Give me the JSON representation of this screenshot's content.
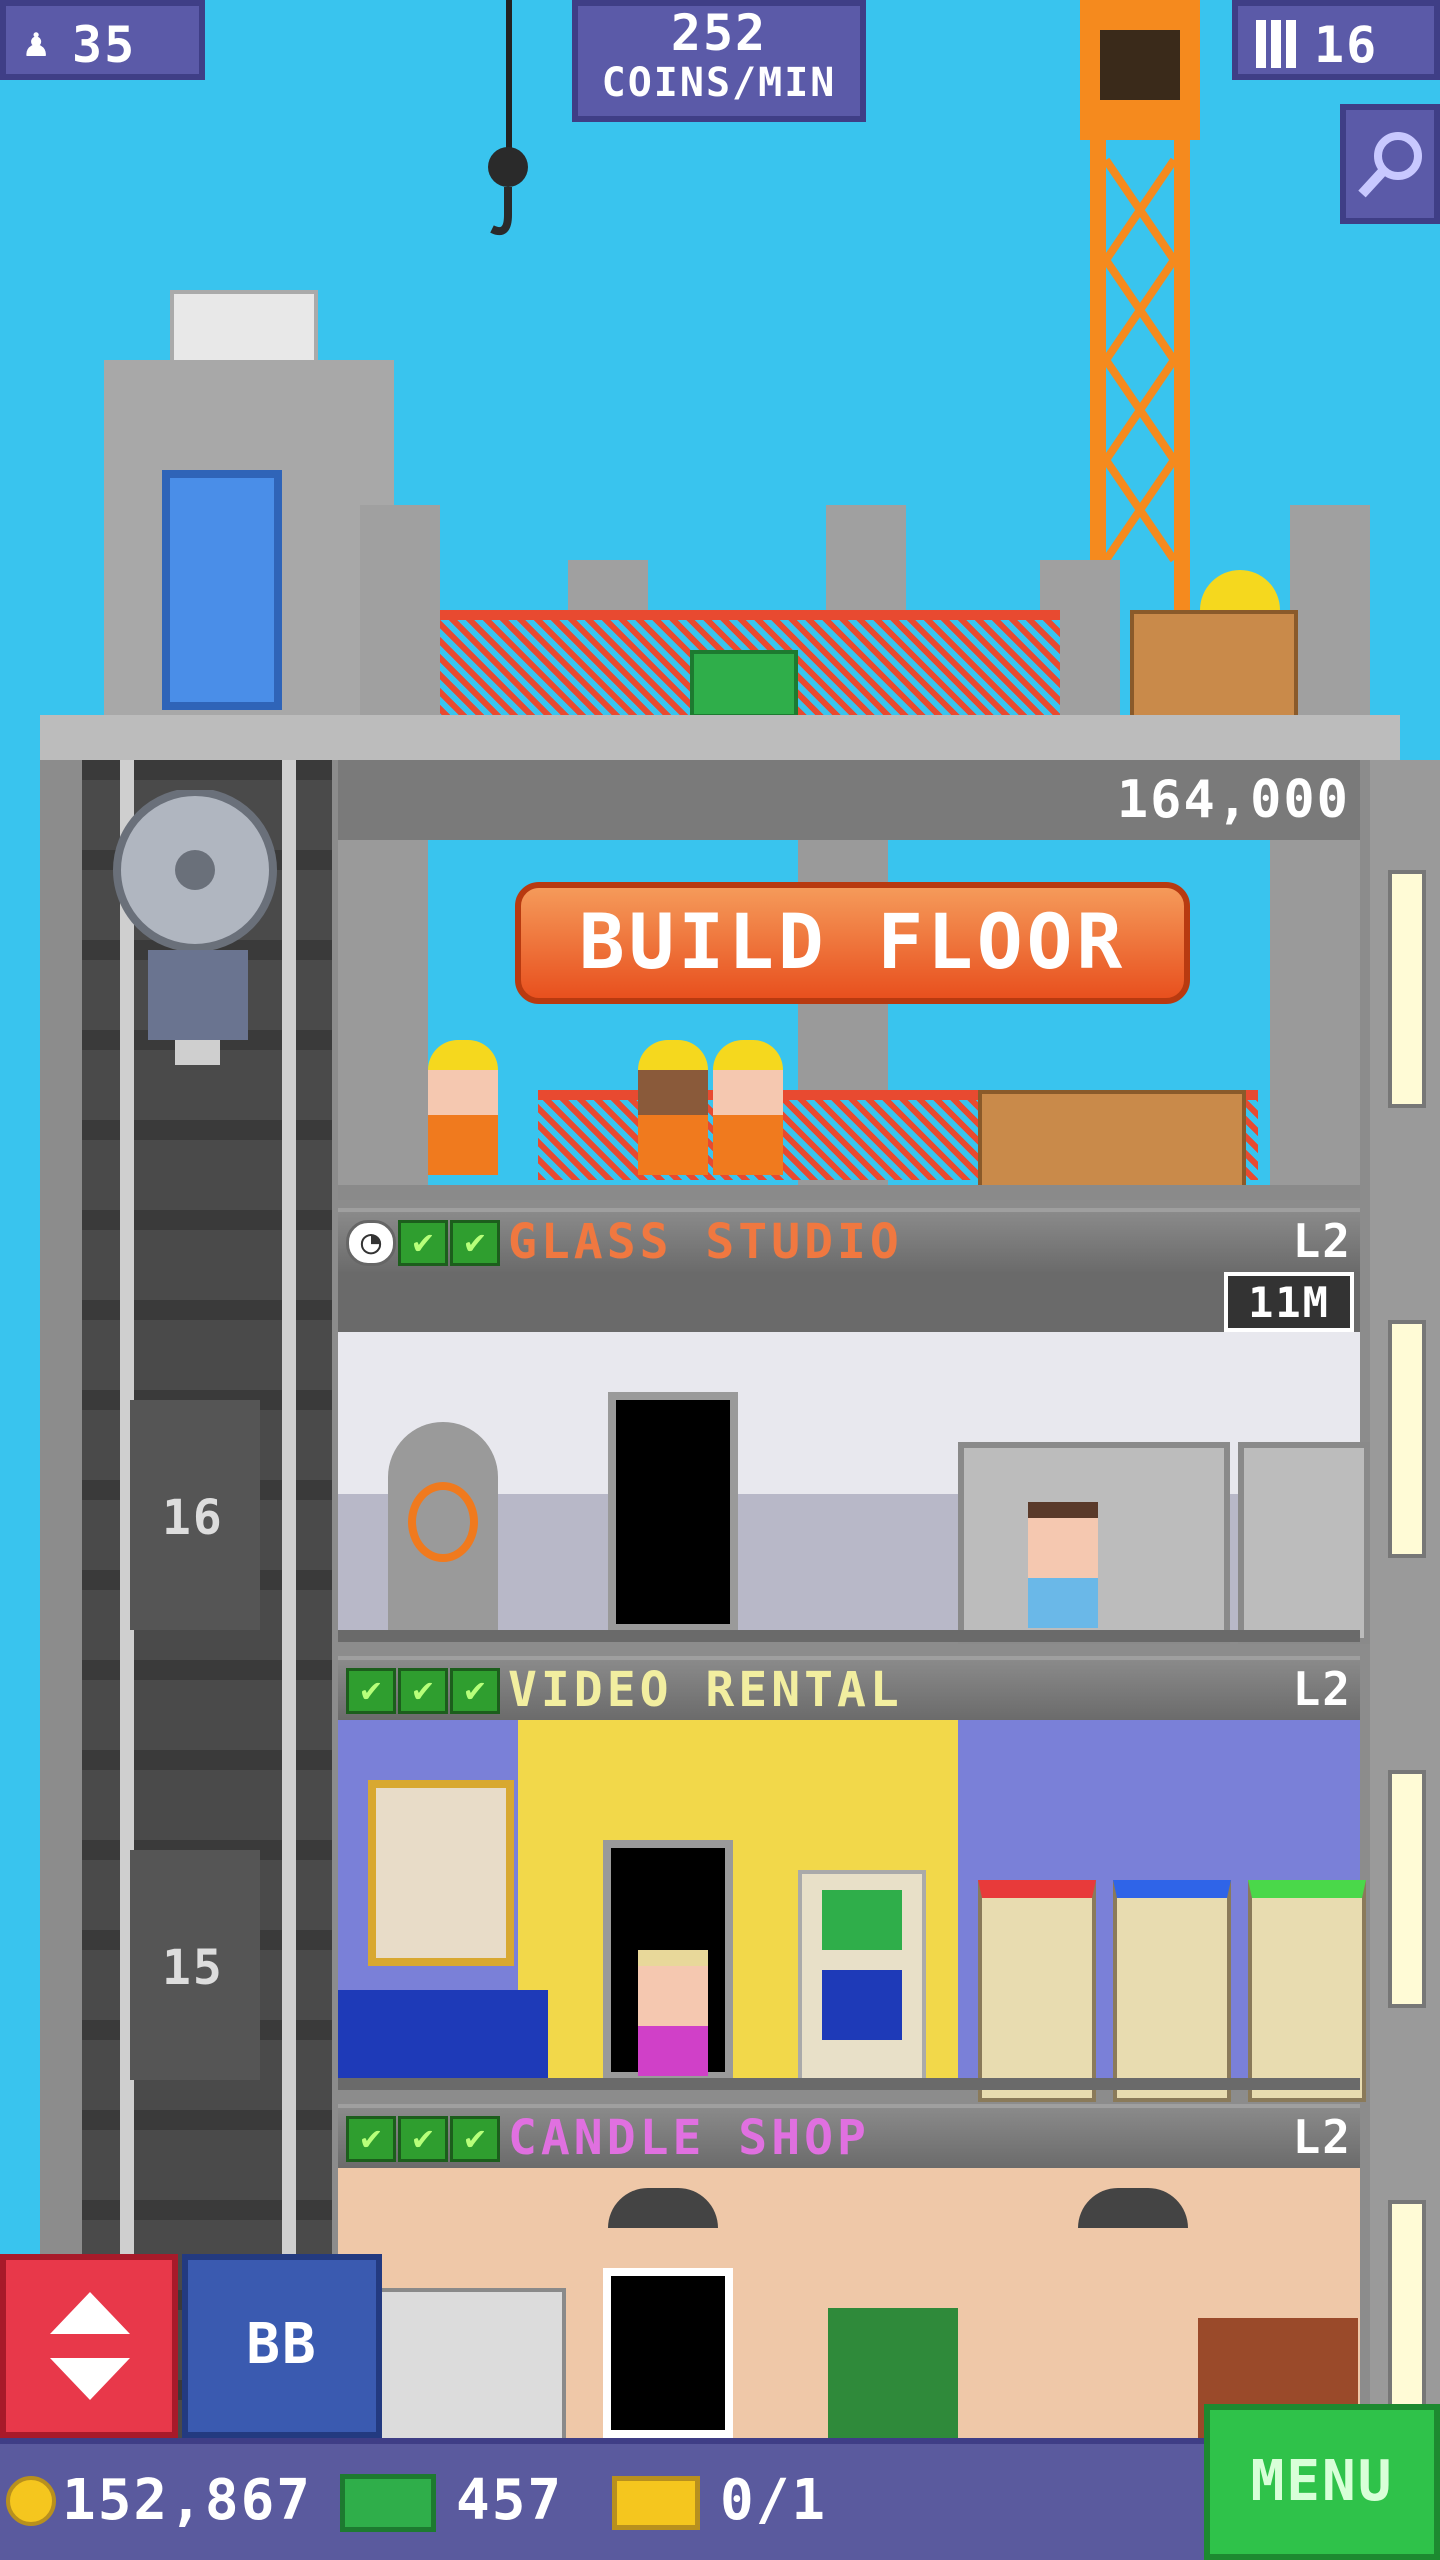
{
  "hud": {
    "residents": "35",
    "coins_per_min_value": "252",
    "coins_per_min_label": "COINS/MIN",
    "floors_count": "16"
  },
  "build": {
    "cost": "164,000",
    "button_label": "BUILD FLOOR"
  },
  "floors": [
    {
      "name": "GLASS STUDIO",
      "level": "L2",
      "badge": "11M",
      "checks": 2,
      "name_color": "#f07840"
    },
    {
      "name": "VIDEO RENTAL",
      "level": "L2",
      "checks": 3,
      "name_color": "#f2eea0"
    },
    {
      "name": "CANDLE SHOP",
      "level": "L2",
      "checks": 3,
      "name_color": "#e070e0"
    }
  ],
  "elevator": {
    "floor_numbers": [
      "16",
      "15"
    ]
  },
  "controls": {
    "bb_label": "BB",
    "menu_label": "MENU"
  },
  "bottom_bar": {
    "coins": "152,867",
    "bux": "457",
    "tickets": "0/1"
  },
  "icons": [
    "person-icon",
    "building-icon",
    "magnifier-icon",
    "elevator-arrows-icon",
    "coin-icon",
    "bux-icon",
    "ticket-icon",
    "clock-icon",
    "check-icon"
  ]
}
